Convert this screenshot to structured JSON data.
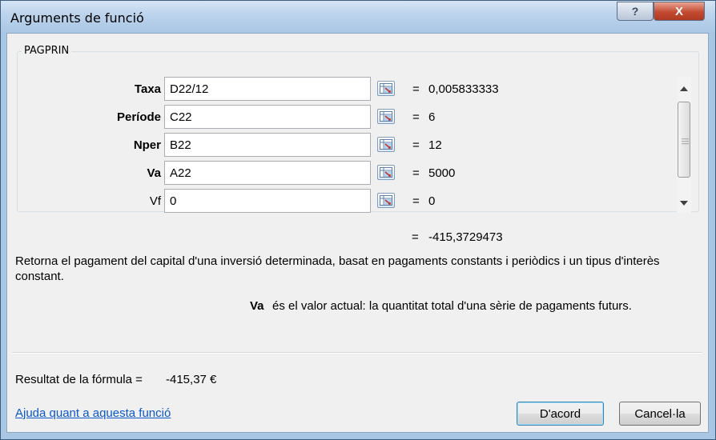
{
  "window": {
    "title": "Arguments de funció",
    "help_label": "?",
    "close_label": "X"
  },
  "function": {
    "name": "PAGPRIN",
    "arguments": [
      {
        "label": "Taxa",
        "bold": true,
        "value": "D22/12",
        "result": "0,005833333"
      },
      {
        "label": "Període",
        "bold": true,
        "value": "C22",
        "result": "6"
      },
      {
        "label": "Nper",
        "bold": true,
        "value": "B22",
        "result": "12"
      },
      {
        "label": "Va",
        "bold": true,
        "value": "A22",
        "result": "5000"
      },
      {
        "label": "Vf",
        "bold": false,
        "value": "0",
        "result": "0"
      }
    ],
    "eq_sign": "=",
    "result_value": "-415,3729473",
    "description": "Retorna el pagament del capital d'una inversió determinada, basat en pagaments constants i periòdics i un tipus d'interès constant.",
    "arg_help_name": "Va",
    "arg_help_text": "és el valor actual: la quantitat total d'una sèrie de pagaments futurs."
  },
  "footer": {
    "formula_result_label": "Resultat de la fórmula =",
    "formula_result_value": "-415,37 €",
    "help_link": "Ajuda quant a aquesta funció",
    "ok_label": "D'acord",
    "cancel_label": "Cancel·la"
  },
  "icons": {
    "help": "question-icon",
    "close": "close-icon",
    "ref": "collapse-dialog-icon"
  }
}
